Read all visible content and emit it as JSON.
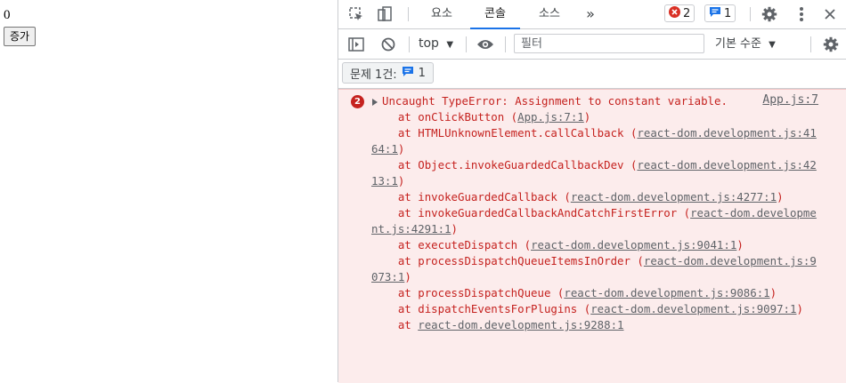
{
  "app": {
    "count": "0",
    "button_label": "증가"
  },
  "devtools": {
    "tabs": [
      {
        "label": "요소"
      },
      {
        "label": "콘솔"
      },
      {
        "label": "소스"
      }
    ],
    "more_tabs": "»",
    "error_badge": "2",
    "message_badge": "1",
    "context": "top",
    "filter_placeholder": "필터",
    "levels": "기본 수준",
    "issues_label": "문제 1건:",
    "issues_count": "1",
    "error": {
      "count": "2",
      "source": "App.js:7",
      "message": "Uncaught TypeError: Assignment to constant variable.",
      "stack": [
        {
          "fn": "onClickButton",
          "loc": "App.js:7:1"
        },
        {
          "fn": "HTMLUnknownElement.callCallback",
          "loc": "react-dom.development.js:4164:1"
        },
        {
          "fn": "Object.invokeGuardedCallbackDev",
          "loc": "react-dom.development.js:4213:1"
        },
        {
          "fn": "invokeGuardedCallback",
          "loc": "react-dom.development.js:4277:1"
        },
        {
          "fn": "invokeGuardedCallbackAndCatchFirstError",
          "loc": "react-dom.development.js:4291:1"
        },
        {
          "fn": "executeDispatch",
          "loc": "react-dom.development.js:9041:1"
        },
        {
          "fn": "processDispatchQueueItemsInOrder",
          "loc": "react-dom.development.js:9073:1"
        },
        {
          "fn": "processDispatchQueue",
          "loc": "react-dom.development.js:9086:1"
        },
        {
          "fn": "dispatchEventsForPlugins",
          "loc": "react-dom.development.js:9097:1"
        },
        {
          "fn": "",
          "loc": "react-dom.development.js:9288:1"
        }
      ]
    }
  },
  "colors": {
    "error_red": "#c5221f",
    "error_bg": "#fcecec",
    "accent": "#1a73e8"
  }
}
